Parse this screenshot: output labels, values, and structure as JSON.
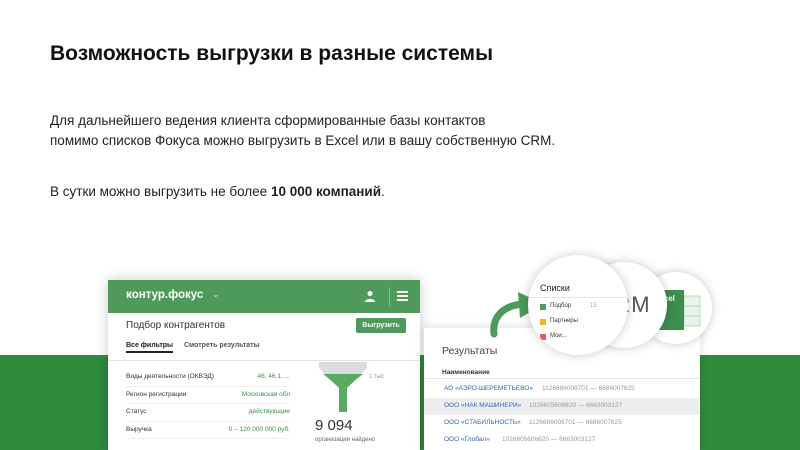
{
  "slide": {
    "title": "Возможность выгрузки в разные системы",
    "para1_line1": "Для дальнейшего ведения клиента сформированные базы контактов",
    "para1_line2": "помимо списков Фокуса можно выгрузить в Excel или в вашу собственную CRM.",
    "para2_prefix": "В сутки можно выгрузить не более ",
    "para2_bold": "10 000 компаний",
    "para2_suffix": "."
  },
  "app": {
    "logo": "кοнтур.фокус",
    "logo_caret": "⌄",
    "page_title": "Подбор контрагентов",
    "export_button": "Выгрузить",
    "tabs": [
      "Все фильтры",
      "Смотреть результаты"
    ],
    "filters": [
      {
        "label": "Виды деятельности (ОКВЭД)",
        "value": "46, 46.1, ..."
      },
      {
        "label": "Регион регистрации",
        "value": "Московская обл"
      },
      {
        "label": "Статус",
        "value": "действующие"
      },
      {
        "label": "Выручка",
        "value": "0 – 120 000 000 руб."
      }
    ],
    "funnel_label": "1 тыс",
    "count": "9 094",
    "count_label": "организации найдено"
  },
  "results": {
    "title": "Результаты",
    "column": "Наименование",
    "rows": [
      {
        "name": "АО «АЭРО-ШЕРЕМЕТЬЕВО»",
        "numbers": "1126686008701 — 6686007625",
        "selected": false
      },
      {
        "name": "ООО «НАК МАШИНЕРИ»",
        "numbers": "1026605606620 — 6663003127",
        "selected": true
      },
      {
        "name": "ООО «СТАБИЛЬНОСТЬ»",
        "numbers": "1126686008701 — 6686007625",
        "selected": false
      },
      {
        "name": "ООО «Глобал»",
        "numbers": "1026605606620 — 6663003127",
        "selected": false
      }
    ]
  },
  "lists_circle": {
    "title": "Списки",
    "items": [
      {
        "label": "Подбор",
        "count": "15",
        "color": "#4d9a5a"
      },
      {
        "label": "Партнеры",
        "count": "",
        "color": "#f0b429"
      },
      {
        "label": "Мои...",
        "count": "",
        "color": "#e05a5a"
      }
    ]
  },
  "crm_circle": {
    "label": "CRM"
  },
  "excel_circle": {
    "label": "Excel"
  },
  "colors": {
    "brand_green": "#4d9a5a",
    "band_green": "#2e8b3e",
    "link_blue": "#2d66b3"
  }
}
